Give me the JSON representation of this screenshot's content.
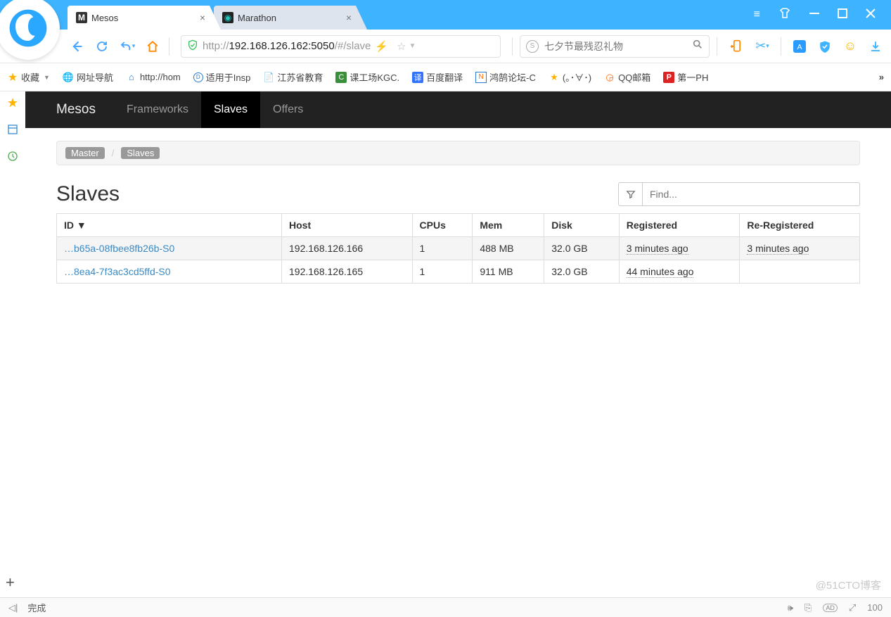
{
  "browser": {
    "tabs": [
      {
        "title": "Mesos",
        "fav": "M"
      },
      {
        "title": "Marathon",
        "fav": "◉"
      }
    ],
    "urlPrefix": "http://",
    "urlHost": "192.168.126.162:5050",
    "urlPath": "/#/slave",
    "searchPlaceholder": "七夕节最残忍礼物"
  },
  "bookmarks": {
    "favLabel": "收藏",
    "items": [
      "网址导航",
      "http://hom",
      "适用于Insp",
      "江苏省教育",
      "课工场KGC.",
      "百度翻译",
      "鸿鹄论坛-C",
      "(｡･∀･)",
      "QQ邮箱",
      "第一PH"
    ]
  },
  "mesos": {
    "brand": "Mesos",
    "nav": [
      "Frameworks",
      "Slaves",
      "Offers"
    ],
    "breadcrumb": [
      "Master",
      "Slaves"
    ],
    "pageTitle": "Slaves",
    "findPlaceholder": "Find...",
    "columns": [
      "ID ▼",
      "Host",
      "CPUs",
      "Mem",
      "Disk",
      "Registered",
      "Re-Registered"
    ],
    "rows": [
      {
        "id": "b65a-08fbee8fb26b-S0",
        "host": "192.168.126.166",
        "cpus": "1",
        "mem": "488 MB",
        "disk": "32.0 GB",
        "reg": "3 minutes ago",
        "rereg": "3 minutes ago"
      },
      {
        "id": "8ea4-7f3ac3cd5ffd-S0",
        "host": "192.168.126.165",
        "cpus": "1",
        "mem": "911 MB",
        "disk": "32.0 GB",
        "reg": "44 minutes ago",
        "rereg": ""
      }
    ]
  },
  "status": {
    "text": "完成"
  },
  "watermark": "@51CTO博客"
}
